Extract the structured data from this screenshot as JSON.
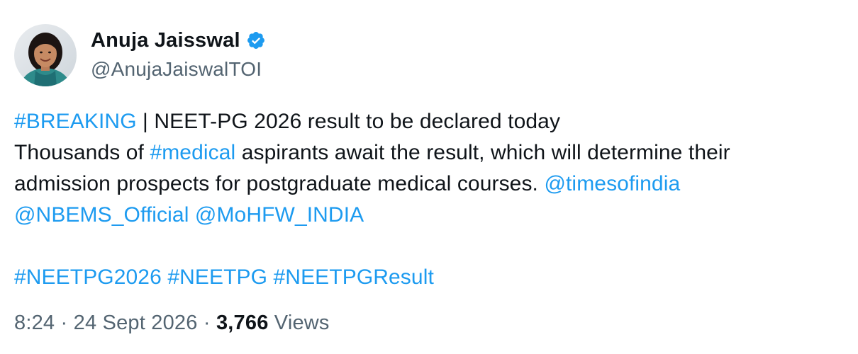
{
  "author": {
    "display_name": "Anuja Jaisswal",
    "handle": "@AnujaJaiswalTOI",
    "verified_icon": "verified-badge-icon",
    "avatar_icon": "profile-photo"
  },
  "tweet": {
    "line1": {
      "hashtag": "#BREAKING",
      "text": " | NEET-PG 2026 result to be declared today"
    },
    "line2": {
      "text_before": "Thousands of ",
      "hashtag": "#medical",
      "text_after": " aspirants await the result, which will determine their"
    },
    "line3": {
      "text": "admission prospects for postgraduate medical courses. ",
      "mention": "@timesofindia"
    },
    "line4": {
      "mention1": "@NBEMS_Official",
      "mention2": "@MoHFW_INDIA"
    },
    "hashtags": [
      "#NEETPG2026",
      "#NEETPG",
      "#NEETPGResult"
    ]
  },
  "meta": {
    "time": "8:24",
    "date": "24 Sept 2026",
    "separator": " · ",
    "views_count": "3,766",
    "views_label": "Views"
  },
  "colors": {
    "link": "#1d9bf0",
    "text": "#0f1419",
    "secondary": "#536471"
  }
}
